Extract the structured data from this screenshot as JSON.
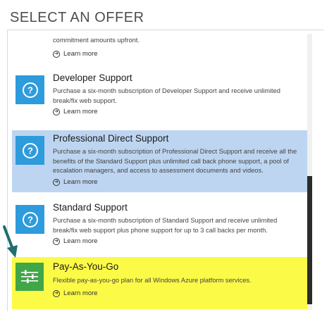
{
  "header": {
    "title": "SELECT AN OFFER"
  },
  "offers": [
    {
      "title": "",
      "description": "commitment amounts upfront.",
      "learn_more": "Learn more"
    },
    {
      "title": "Developer Support",
      "description": "Purchase a six-month subscription of Developer Support and receive unlimited break/fix web support.",
      "learn_more": "Learn more",
      "icon": "question-icon"
    },
    {
      "title": "Professional Direct Support",
      "description": "Purchase a six-month subscription of Professional Direct Support and receive all the benefits of the Standard Support plus unlimited call back phone support, a pool of escalation managers, and access to assessment documents and videos.",
      "learn_more": "Learn more",
      "icon": "question-icon",
      "state": "selected-hover"
    },
    {
      "title": "Standard Support",
      "description": "Purchase a six-month subscription of Standard Support and receive unlimited break/fix web support plus phone support for up to 3 call backs per month.",
      "learn_more": "Learn more",
      "icon": "question-icon"
    },
    {
      "title": "Pay-As-You-Go",
      "description": "Flexible pay-as-you-go plan for all Windows Azure platform services.",
      "learn_more": "Learn more",
      "icon": "sliders-icon",
      "state": "highlighted"
    }
  ],
  "colors": {
    "support_tile": "#2e9bdc",
    "payg_tile": "#40a648",
    "selected_background": "#bdd5f0",
    "highlight_background": "#fbfa47",
    "pointer_arrow": "#1f6f70"
  }
}
